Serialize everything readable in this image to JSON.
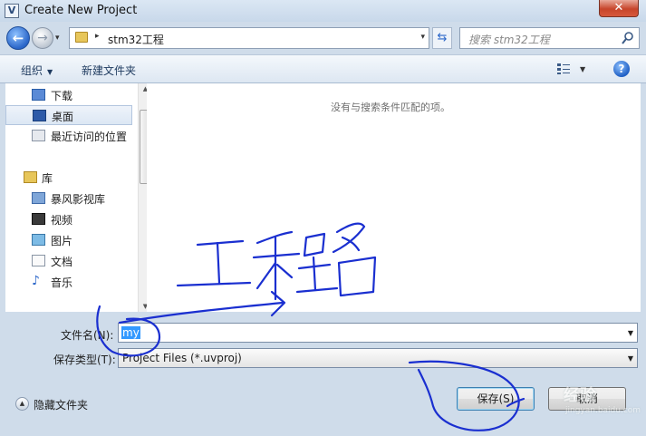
{
  "window": {
    "title": "Create New Project",
    "app_icon": "V",
    "close_glyph": "✕"
  },
  "nav": {
    "back_glyph": "←",
    "forward_glyph": "→",
    "history_glyph": "▾",
    "address": {
      "crumb": "stm32工程",
      "separator": "▸",
      "dropdown_glyph": "▾"
    },
    "refresh_glyph": "⇆",
    "search": {
      "placeholder": "搜索 stm32工程",
      "icon": "search-icon"
    }
  },
  "toolbar": {
    "organize_label": "组织",
    "organize_caret": "▼",
    "new_folder_label": "新建文件夹",
    "view_caret": "▼",
    "help_glyph": "?"
  },
  "sidebar": {
    "items": [
      {
        "label": "下载",
        "icon": "download-folder-icon"
      },
      {
        "label": "桌面",
        "icon": "desktop-icon",
        "selected": true
      },
      {
        "label": "最近访问的位置",
        "icon": "recent-places-icon"
      },
      {
        "label": "库",
        "icon": "library-icon"
      },
      {
        "label": "暴风影视库",
        "icon": "storm-library-icon"
      },
      {
        "label": "视频",
        "icon": "video-icon"
      },
      {
        "label": "图片",
        "icon": "pictures-icon"
      },
      {
        "label": "文档",
        "icon": "documents-icon"
      },
      {
        "label": "音乐",
        "icon": "music-icon"
      }
    ]
  },
  "content": {
    "empty_message": "没有与搜索条件匹配的项。"
  },
  "form": {
    "filename_label": "文件名(N):",
    "filename_value": "my",
    "filetype_label": "保存类型(T):",
    "filetype_value": "Project Files (*.uvproj)"
  },
  "footer": {
    "hide_folders_label": "隐藏文件夹",
    "hide_glyph": "▲"
  },
  "buttons": {
    "save_label": "保存(S)",
    "cancel_label": "取消"
  },
  "watermark": {
    "text": "经验",
    "sub": "jingyan.baidu.com"
  },
  "colors": {
    "annotation_ink": "#1a2fd0",
    "selection": "#3399ff",
    "accent": "#2a66c9"
  }
}
